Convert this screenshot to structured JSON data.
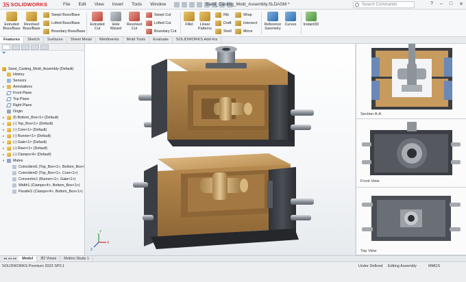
{
  "app": {
    "brand": "SOLIDWORKS",
    "document_title": "Sand_Casting_Mold_Assembly.SLDASM *",
    "menu": [
      "File",
      "Edit",
      "View",
      "Insert",
      "Tools",
      "Window"
    ],
    "search_placeholder": "Search Commands"
  },
  "ribbon": {
    "large": [
      {
        "name": "extruded-boss",
        "label1": "Extruded",
        "label2": "Boss/Base"
      },
      {
        "name": "revolved-boss",
        "label1": "Revolved",
        "label2": "Boss/Base"
      },
      {
        "name": "extruded-cut",
        "label1": "Extruded",
        "label2": "Cut"
      },
      {
        "name": "hole-wizard",
        "label1": "Hole",
        "label2": "Wizard"
      },
      {
        "name": "revolved-cut",
        "label1": "Revolved",
        "label2": "Cut"
      },
      {
        "name": "fillet",
        "label1": "Fillet",
        "label2": ""
      },
      {
        "name": "linear-pattern",
        "label1": "Linear",
        "label2": "Patterns"
      },
      {
        "name": "reference-geometry",
        "label1": "Reference",
        "label2": "Geometry"
      },
      {
        "name": "curves",
        "label1": "Curves",
        "label2": ""
      },
      {
        "name": "instant3d",
        "label1": "Instant3D",
        "label2": ""
      }
    ],
    "small": {
      "swept_boss": "Swept Boss/Base",
      "lofted_boss": "Lofted Boss/Base",
      "boundary_boss": "Boundary Boss/Base",
      "swept_cut": "Swept Cut",
      "lofted_cut": "Lofted Cut",
      "boundary_cut": "Boundary Cut",
      "rib": "Rib",
      "draft": "Draft",
      "shell": "Shell",
      "wrap": "Wrap",
      "intersect": "Intersect",
      "mirror": "Mirror"
    }
  },
  "tabs": [
    "Features",
    "Sketch",
    "Surfaces",
    "Sheet Metal",
    "Weldments",
    "Mold Tools",
    "Evaluate",
    "SOLIDWORKS Add-Ins"
  ],
  "active_tab": "Features",
  "tree": {
    "root": "Sand_Casting_Mold_Assembly (Default)",
    "items": [
      {
        "label": "History",
        "icon": "history-icon",
        "twisty": ""
      },
      {
        "label": "Sensors",
        "icon": "sensor-icon",
        "twisty": ""
      },
      {
        "label": "Annotations",
        "icon": "annotations-icon",
        "twisty": "▸"
      },
      {
        "label": "Front Plane",
        "icon": "plane-icon",
        "twisty": ""
      },
      {
        "label": "Top Plane",
        "icon": "plane-icon",
        "twisty": ""
      },
      {
        "label": "Right Plane",
        "icon": "plane-icon",
        "twisty": ""
      },
      {
        "label": "Origin",
        "icon": "origin-icon",
        "twisty": ""
      },
      {
        "label": "(f) Bottom_Box<1> (Default)",
        "icon": "part-icon",
        "twisty": "▸"
      },
      {
        "label": "(-) Top_Box<1> (Default)",
        "icon": "part-icon",
        "twisty": "▸"
      },
      {
        "label": "(-) Core<1> (Default)",
        "icon": "part-icon",
        "twisty": "▸"
      },
      {
        "label": "(-) Runner<1> (Default)",
        "icon": "part-icon",
        "twisty": "▸"
      },
      {
        "label": "(-) Gate<1> (Default)",
        "icon": "part-icon",
        "twisty": "▸"
      },
      {
        "label": "(-) Riser<1> (Default)",
        "icon": "part-icon",
        "twisty": "▸"
      },
      {
        "label": "(-) Clamps<4> (Default)",
        "icon": "part-icon",
        "twisty": "▸"
      },
      {
        "label": "Mates",
        "icon": "mates-icon",
        "twisty": "▾"
      }
    ],
    "mates": [
      "Coincident1 (Top_Box<1>, Bottom_Box<1>)",
      "Coincident2 (Top_Box<1>, Core<1>)",
      "Concentric1 (Runner<1>, Gate<1>)",
      "Width1 (Clamps<4>, Bottom_Box<1>)",
      "Parallel1 (Clamps<4>, Bottom_Box<1>)"
    ]
  },
  "bottom_tabs": [
    "Model",
    "3D Views",
    "Motion Study 1"
  ],
  "active_bottom_tab": "Model",
  "views": [
    {
      "label": "Section A-A"
    },
    {
      "label": "Front View"
    },
    {
      "label": "Top View"
    }
  ],
  "status": {
    "product": "SOLIDWORKS Premium 2023 SP0.1",
    "definition": "Under Defined",
    "mode": "Editing Assembly",
    "units": "MMGS"
  },
  "colors": {
    "sand": "#c79a5e",
    "metal_dark": "#3a3d42",
    "brass": "#c9a46a",
    "brand_red": "#d9232d"
  }
}
